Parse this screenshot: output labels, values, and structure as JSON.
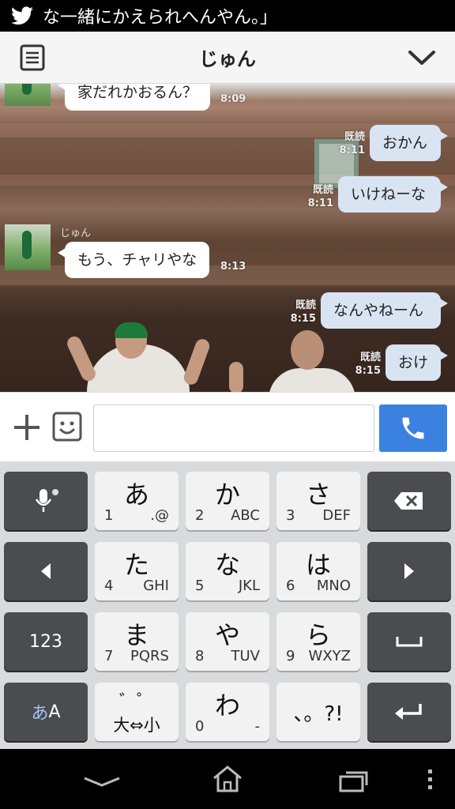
{
  "notification": {
    "icon": "twitter-bird-icon",
    "text": "な一緒にかえられへんやん。」"
  },
  "header": {
    "title": "じゅん",
    "menu_icon": "list-icon",
    "collapse_icon": "chevron-down-icon"
  },
  "messages": [
    {
      "side": "in",
      "text": "家だれかおるん？",
      "time": "8:09"
    },
    {
      "side": "out",
      "text": "おかん",
      "read": "既読",
      "time": "8:11"
    },
    {
      "side": "out",
      "text": "いけねーな",
      "read": "既読",
      "time": "8:11"
    },
    {
      "side": "in",
      "sender": "じゅん",
      "text": "もう、チャリやな",
      "time": "8:13"
    },
    {
      "side": "out",
      "text": "なんやねーん",
      "read": "既読",
      "time": "8:15"
    },
    {
      "side": "out",
      "text": "おけ",
      "read": "既読",
      "time": "8:15"
    }
  ],
  "input": {
    "value": "",
    "placeholder": ""
  },
  "keyboard": {
    "row1": [
      {
        "icon": "microphone-icon"
      },
      {
        "kana": "あ",
        "num": "1",
        "sub": ".@"
      },
      {
        "kana": "か",
        "num": "2",
        "sub": "ABC"
      },
      {
        "kana": "さ",
        "num": "3",
        "sub": "DEF"
      },
      {
        "icon": "backspace-icon"
      }
    ],
    "row2": [
      {
        "icon": "arrow-left-icon"
      },
      {
        "kana": "た",
        "num": "4",
        "sub": "GHI"
      },
      {
        "kana": "な",
        "num": "5",
        "sub": "JKL"
      },
      {
        "kana": "は",
        "num": "6",
        "sub": "MNO"
      },
      {
        "icon": "arrow-right-icon"
      }
    ],
    "row3": [
      {
        "label": "123"
      },
      {
        "kana": "ま",
        "num": "7",
        "sub": "PQRS"
      },
      {
        "kana": "や",
        "num": "8",
        "sub": "TUV"
      },
      {
        "kana": "ら",
        "num": "9",
        "sub": "WXYZ"
      },
      {
        "icon": "space-icon"
      }
    ],
    "row4": [
      {
        "label_a": "あ",
        "label_b": "A"
      },
      {
        "top": "゛゜",
        "bottom": "大⇔小"
      },
      {
        "kana": "わ",
        "num": "0",
        "sub": "-"
      },
      {
        "label": "、。?!"
      },
      {
        "icon": "enter-icon"
      }
    ]
  },
  "colors": {
    "accent": "#3b82e0",
    "bubble_out": "#d9e4f3",
    "key_dark": "#4a4c4f",
    "key_light": "#f2f2f2"
  }
}
